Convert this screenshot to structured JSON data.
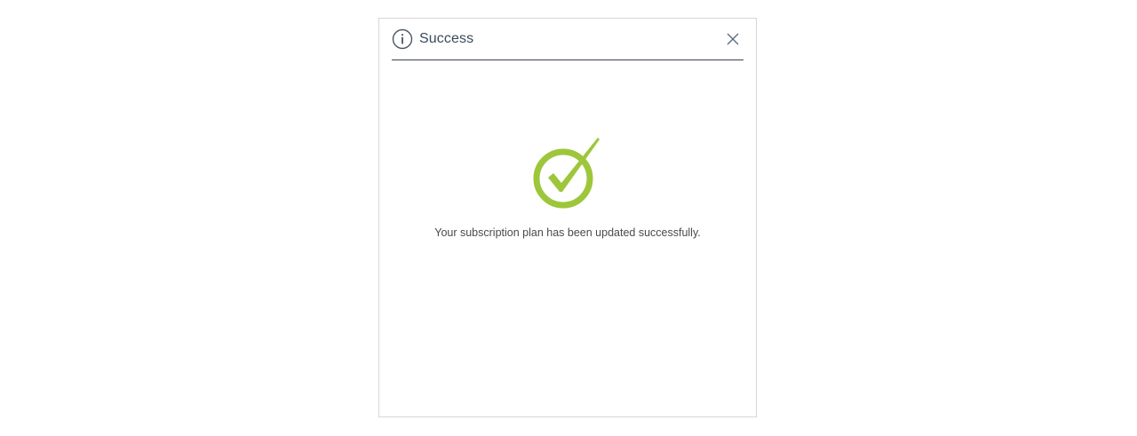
{
  "dialog": {
    "title": "Success",
    "message": "Your subscription plan has been updated successfully.",
    "header_icon": "info-icon",
    "close_icon": "close-icon",
    "status_icon": "check-circle-icon"
  },
  "colors": {
    "success": "#9dc63a",
    "header_text": "#3b4a5c",
    "icon_stroke": "#4a5566",
    "border": "#d6d6d6"
  }
}
